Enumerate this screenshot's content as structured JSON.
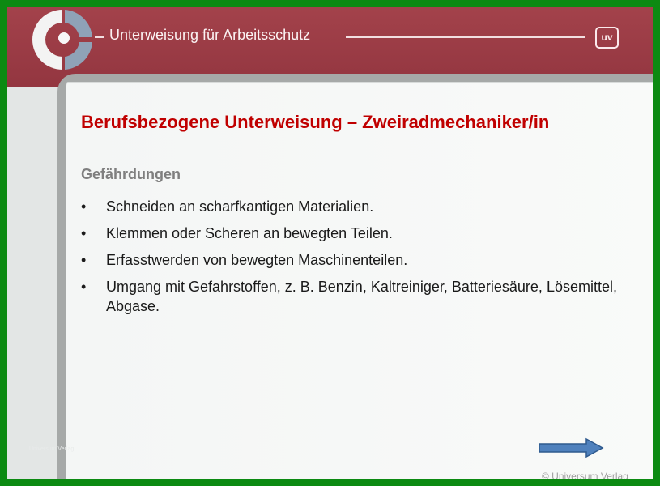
{
  "header": {
    "title": "Unterweisung für Arbeitsschutz",
    "badge": "uv",
    "logo_icon": "ring-logo-icon"
  },
  "slide": {
    "title": "Berufsbezogene Unterweisung – Zweiradmechaniker/in",
    "subheading": "Gefährdungen",
    "bullet_char": "•",
    "bullets": [
      "Schneiden an scharfkantigen Materialien.",
      "Klemmen oder Scheren an bewegten Teilen.",
      "Erfasstwerden von bewegten Maschinenteilen.",
      "Umgang mit Gefahrstoffen, z. B. Benzin, Kaltreiniger, Batteriesäure, Lösemittel, Abgase."
    ]
  },
  "footer": {
    "faint_text": "Universum Verlag",
    "next_icon": "right-arrow-icon",
    "copyright": "© Universum Verlag"
  },
  "colors": {
    "frame": "#0c8a12",
    "header": "#9b3b44",
    "title": "#c00000",
    "subheading": "#7f7f7f",
    "arrow": "#4f81bd"
  }
}
